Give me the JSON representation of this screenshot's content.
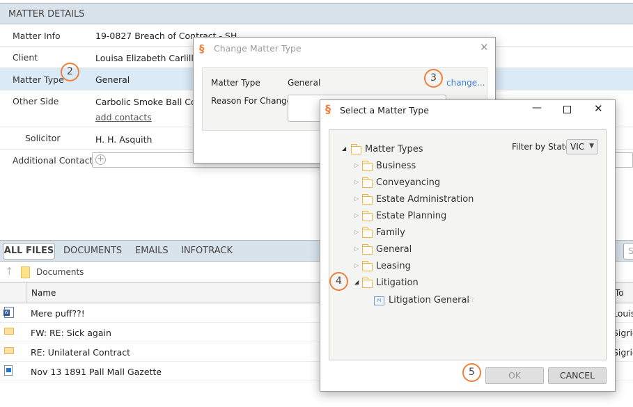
{
  "matter_details": {
    "header": "MATTER DETAILS",
    "rows": [
      {
        "label": "Matter Info",
        "value": "19-0827 Breach of Contract - SH"
      },
      {
        "label": "Client",
        "value": "Louisa Elizabeth Carlill"
      },
      {
        "label": "Matter Type",
        "value": "General"
      },
      {
        "label": "Other Side",
        "value": "Carbolic Smoke Ball Co",
        "link": "add contacts"
      },
      {
        "label": "Solicitor",
        "value": "H. H. Asquith"
      },
      {
        "label": "Additional Contact",
        "value": ""
      }
    ]
  },
  "steps": [
    "2",
    "3",
    "4",
    "5"
  ],
  "files": {
    "tabs": [
      "ALL FILES",
      "DOCUMENTS",
      "EMAILS",
      "INFOTRACK"
    ],
    "active_tab": "ALL FILES",
    "breadcrumb": "Documents",
    "search_placeholder": "S",
    "columns": [
      "Name",
      "To"
    ],
    "rows": [
      {
        "icon": "word-doc",
        "name": "Mere puff??!",
        "to": "Louis"
      },
      {
        "icon": "email",
        "name": "FW: RE: Sick again",
        "to": "Sigric"
      },
      {
        "icon": "email",
        "name": "RE: Unilateral Contract",
        "to": "Sigric"
      },
      {
        "icon": "image",
        "name": "Nov 13 1891 Pall Mall Gazette",
        "to": ""
      }
    ]
  },
  "change_dialog": {
    "title": "Change Matter Type",
    "matter_type_label": "Matter Type",
    "matter_type_value": "General",
    "change_link": "change...",
    "reason_label": "Reason For Change",
    "reason_value": ""
  },
  "select_dialog": {
    "title": "Select a Matter Type",
    "filter_label": "Filter by State",
    "filter_value": "VIC",
    "root": "Matter Types",
    "categories": [
      "Business",
      "Conveyancing",
      "Estate Administration",
      "Estate Planning",
      "Family",
      "General",
      "Leasing",
      "Litigation"
    ],
    "expanded_child": "Litigation General",
    "ok": "OK",
    "cancel": "CANCEL"
  },
  "colors": {
    "accent": "#ee7f3a",
    "header_bg": "#d9e3ec",
    "selected_row": "#daeaf7",
    "link": "#3b82d6"
  }
}
